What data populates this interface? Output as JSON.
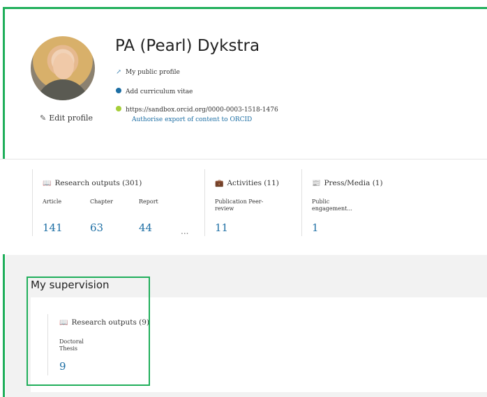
{
  "profile": {
    "name": "PA (Pearl) Dykstra",
    "public_profile": "My public profile",
    "add_cv": "Add curriculum vitae",
    "orcid_url": "https://sandbox.orcid.org/0000-0003-1518-1476",
    "orcid_auth": "Authorise export of content to ORCID",
    "edit_profile": "Edit profile"
  },
  "stats": {
    "research_outputs": {
      "title": "Research outputs (301)",
      "items": [
        {
          "label": "Article",
          "value": "141"
        },
        {
          "label": "Chapter",
          "value": "63"
        },
        {
          "label": "Report",
          "value": "44"
        }
      ],
      "more": "..."
    },
    "activities": {
      "title": "Activities (11)",
      "label": "Publication Peer-review",
      "value": "11"
    },
    "press": {
      "title": "Press/Media (1)",
      "label": "Public engagement...",
      "value": "1"
    }
  },
  "supervision": {
    "title": "My supervision",
    "research_outputs": {
      "title": "Research outputs (9)",
      "label": "Doctoral Thesis",
      "value": "9"
    }
  },
  "colors": {
    "accent": "#1c6ea4",
    "highlight": "#1fae5a",
    "orcid": "#a6ce39"
  }
}
